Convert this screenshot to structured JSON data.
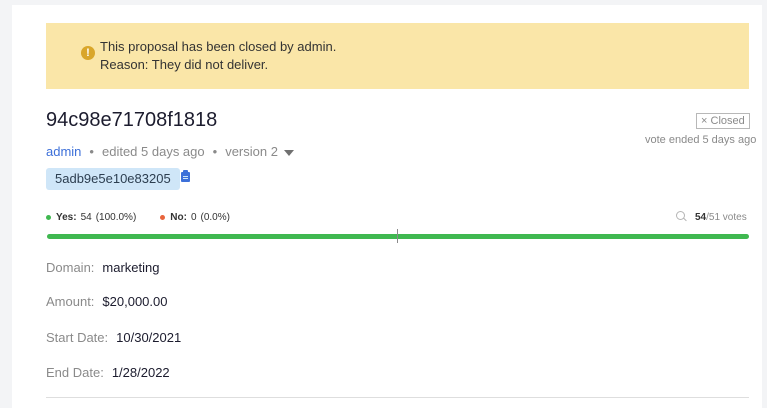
{
  "colors": {
    "alert_bg": "#fae6a8",
    "alert_icon": "#d9a62a",
    "link": "#3d70d9",
    "yes": "#3fb850",
    "no": "#e8643c",
    "chip_bg": "#cfe6f8"
  },
  "alert": {
    "icon": "exclamation-icon",
    "line1": "This proposal has been closed by admin.",
    "line2": "Reason: They did not deliver."
  },
  "proposal": {
    "title": "94c98e71708f1818",
    "status": "Closed",
    "status_icon": "×",
    "vote_ended": "vote ended 5 days ago",
    "author": "admin",
    "dot": "•",
    "edited": "edited 5 days ago",
    "version": "version 2",
    "hash": "5adb9e5e10e83205"
  },
  "votes": {
    "yes_label": "Yes:",
    "yes_count": "54",
    "yes_pct": "(100.0%)",
    "no_label": "No:",
    "no_count": "0",
    "no_pct": "(0.0%)",
    "count": "54",
    "total": "/51 votes",
    "yes_fraction": 1.0
  },
  "details": {
    "domain_label": "Domain:",
    "domain": "marketing",
    "amount_label": "Amount:",
    "amount": "$20,000.00",
    "start_label": "Start Date:",
    "start": "10/30/2021",
    "end_label": "End Date:",
    "end": "1/28/2022"
  }
}
